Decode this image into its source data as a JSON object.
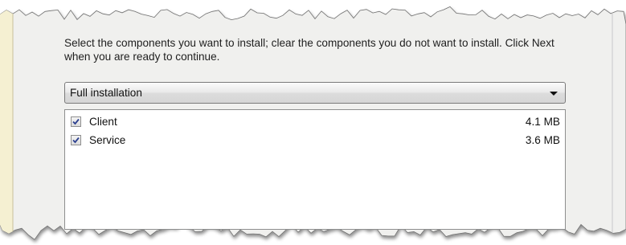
{
  "instructions": {
    "text": "Select the components you want to install; clear the components you do not want to install. Click Next when you are ready to continue."
  },
  "install_type": {
    "selected": "Full installation"
  },
  "components": [
    {
      "label": "Client",
      "size": "4.1 MB",
      "checked": true
    },
    {
      "label": "Service",
      "size": "3.6 MB",
      "checked": true
    }
  ],
  "colors": {
    "panel_background": "#f0f0ee",
    "sidebar_strip": "#f5f0d2",
    "checkmark": "#2b3f8f"
  }
}
